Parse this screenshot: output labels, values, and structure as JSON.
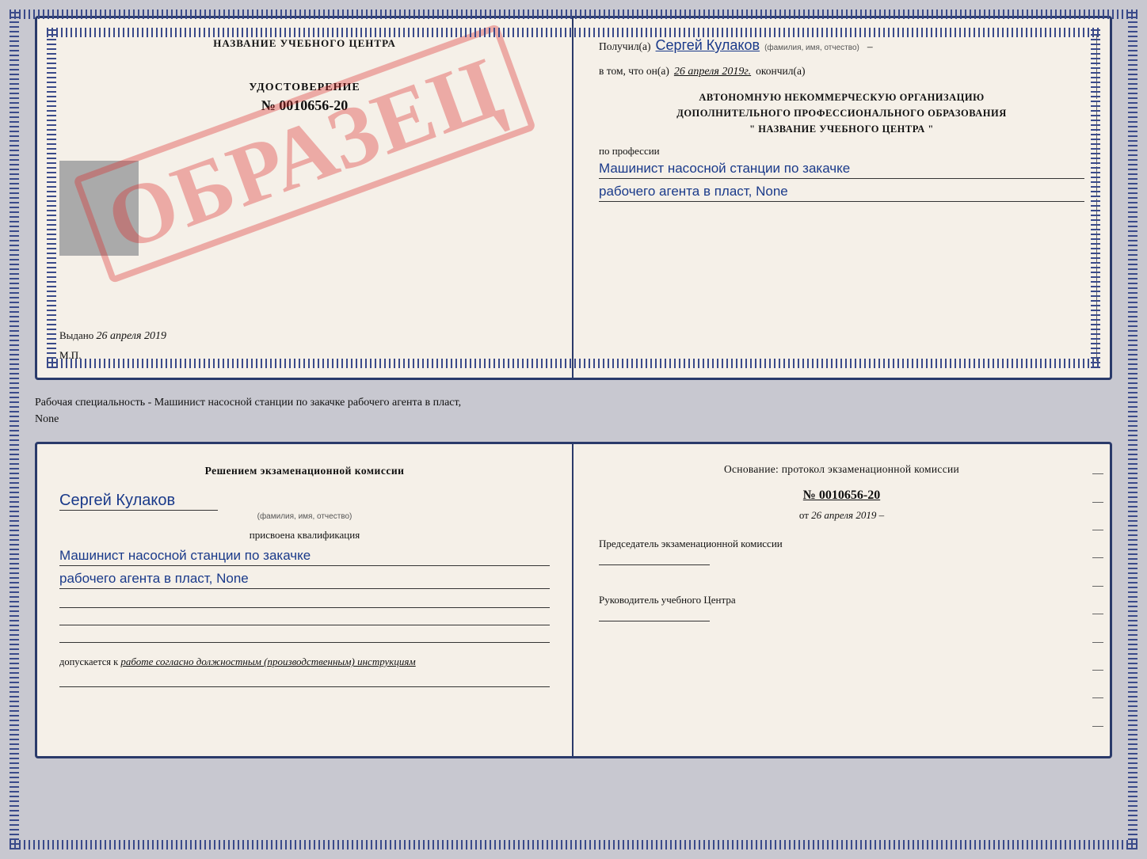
{
  "cert_top": {
    "left": {
      "school_name": "НАЗВАНИЕ УЧЕБНОГО ЦЕНТРА",
      "obrazec": "ОБРАЗЕЦ",
      "udostoverenie_label": "УДОСТОВЕРЕНИЕ",
      "number": "№ 0010656-20",
      "vydano_label": "Выдано",
      "vydano_date": "26 апреля 2019",
      "mp": "М.П."
    },
    "right": {
      "poluchil_label": "Получил(а)",
      "recipient_name": "Сергей Кулаков",
      "recipient_sublabel": "(фамилия, имя, отчество)",
      "vtom_label": "в том, что он(а)",
      "date_value": "26 апреля 2019г.",
      "okonchil_label": "окончил(а)",
      "org_line1": "АВТОНОМНУЮ НЕКОММЕРЧЕСКУЮ ОРГАНИЗАЦИЮ",
      "org_line2": "ДОПОЛНИТЕЛЬНОГО ПРОФЕССИОНАЛЬНОГО ОБРАЗОВАНИЯ",
      "org_line3": "\"  НАЗВАНИЕ УЧЕБНОГО ЦЕНТРА  \"",
      "po_professii": "по профессии",
      "profession_line1": "Машинист насосной станции по закачке",
      "profession_line2": "рабочего агента в пласт, None"
    }
  },
  "middle": {
    "text": "Рабочая специальность - Машинист насосной станции по закачке рабочего агента в пласт,",
    "text2": "None"
  },
  "cert_bottom": {
    "left": {
      "resheniem_label": "Решением экзаменационной комиссии",
      "name_handwritten": "Сергей Кулаков",
      "name_sublabel": "(фамилия, имя, отчество)",
      "prisvoena_label": "присвоена квалификация",
      "qual_line1": "Машинист насосной станции по закачке",
      "qual_line2": "рабочего агента в пласт, None",
      "dopuskaetsya_label": "допускается к",
      "dopusk_text": "работе согласно должностным (производственным) инструкциям"
    },
    "right": {
      "osnovanie_label": "Основание: протокол экзаменационной комиссии",
      "protocol_number": "№ 0010656-20",
      "ot_label": "от",
      "date_value": "26 апреля 2019",
      "predsedatel_label": "Председатель экзаменационной комиссии",
      "rukovoditel_label": "Руководитель учебного Центра"
    }
  }
}
